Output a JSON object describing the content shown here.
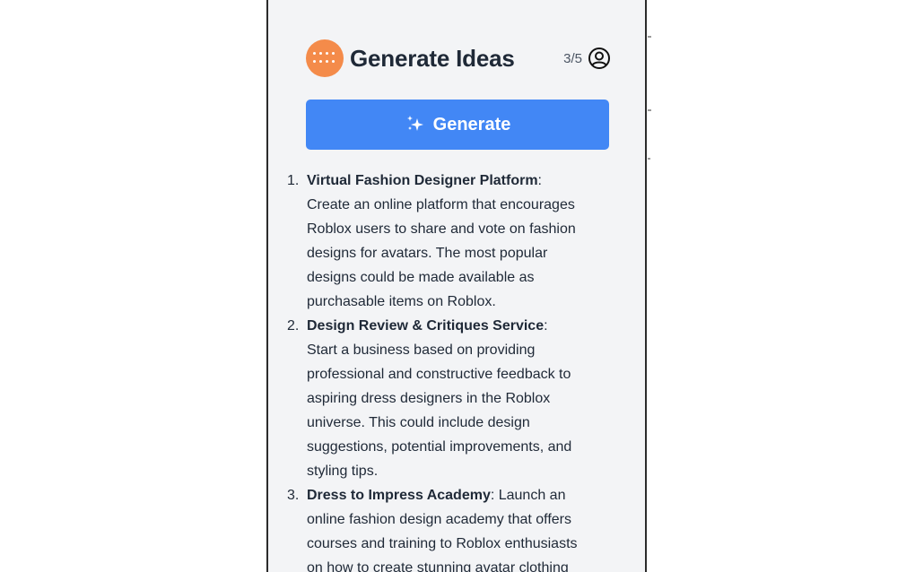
{
  "header": {
    "title": "Generate Ideas",
    "counter": "3/5",
    "logo_icon": "dots-logo-icon",
    "account_icon": "user-circle-icon"
  },
  "generate_button": {
    "label": "Generate",
    "icon": "sparkles-icon"
  },
  "ideas": [
    {
      "number": "1.",
      "name": "Virtual Fashion Designer Platform",
      "separator": ":",
      "lines": [
        "Create an online platform that encourages",
        "Roblox users to share and vote on fashion",
        "designs for avatars. The most popular",
        "designs could be made available as",
        "purchasable items on Roblox."
      ]
    },
    {
      "number": "2.",
      "name": "Design Review & Critiques Service",
      "separator": ":",
      "lines": [
        "Start a business based on providing",
        "professional and constructive feedback to",
        "aspiring dress designers in the Roblox",
        "universe. This could include design",
        "suggestions, potential improvements, and",
        "styling tips."
      ]
    },
    {
      "number": "3.",
      "name": "Dress to Impress Academy",
      "separator": ": Launch an",
      "lines": [
        "online fashion design academy that offers",
        "courses and training to Roblox enthusiasts",
        "on how to create stunning avatar clothing"
      ]
    }
  ],
  "colors": {
    "panel_bg": "#f3f4f6",
    "accent": "#4287f5",
    "logo": "#f48b4a",
    "text": "#1f2937"
  }
}
